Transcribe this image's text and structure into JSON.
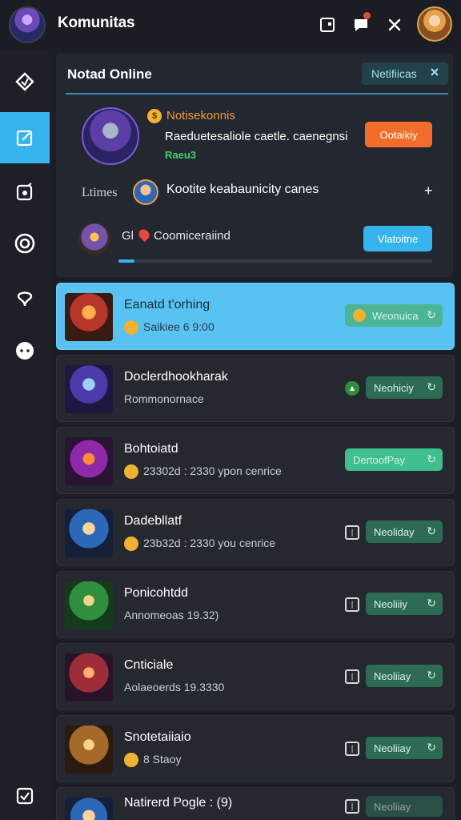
{
  "app": {
    "title": "Komunitas"
  },
  "header": {
    "icons": [
      "window-icon",
      "chat-icon",
      "close-icon"
    ],
    "notification_dot": true
  },
  "sidebar": {
    "items": [
      "home-icon",
      "edit-icon",
      "note-icon",
      "target-icon",
      "pin-icon",
      "chat-icon",
      "check-icon"
    ],
    "active_index": 1
  },
  "panel": {
    "title": "Notad Online",
    "tag_label": "Netifiicas",
    "featured": {
      "name": "Notisekonnis",
      "description": "Raeduetesaliole caetle. caenegnsi",
      "sub": "Raeu3",
      "button": "Ootaikiy"
    },
    "row2": {
      "label": "Ltimes",
      "text": "Kootite keabaunicity canes",
      "plus": "+"
    },
    "row3": {
      "text": "Gl",
      "text2": "Coomiceraiind",
      "button": "Vlatoitne",
      "progress": 0.05
    }
  },
  "list": [
    {
      "title": "Eanatd t'orhing",
      "sub": "Saikiee 6 9:00",
      "chip": "Weonuica",
      "active": true,
      "icon": "coin"
    },
    {
      "title": "Doclerdhookharak",
      "sub": "Rommonornace",
      "chip": "Neohiciy",
      "active": false,
      "icon": "leaf"
    },
    {
      "title": "Bohtoiatd",
      "sub": "23302d : 2330 ypon cenrice",
      "chip": "DertoofPay",
      "active": false,
      "icon": "coin"
    },
    {
      "title": "Dadebllatf",
      "sub": "23b32d : 2330 you cenrice",
      "chip": "Neoliday",
      "active": false,
      "icon": "coin"
    },
    {
      "title": "Ponicohtdd",
      "sub": "Annomeoas 19.32)",
      "chip": "Neoliiiy",
      "active": false,
      "icon": "none"
    },
    {
      "title": "Cnticiale",
      "sub": "Aolaeoerds 19.3330",
      "chip": "Neoliiay",
      "active": false,
      "icon": "none"
    },
    {
      "title": "Snotetaiiaio",
      "sub": "8 Staoy",
      "chip": "Neoliiay",
      "active": false,
      "icon": "coin"
    },
    {
      "title": "Natirerd Pogle : (9)",
      "sub": "",
      "chip": "Neoliiay",
      "active": false,
      "icon": "none"
    }
  ],
  "colors": {
    "accent": "#37b3ee",
    "orange": "#f36d2a",
    "green_chip": "#2e6b55"
  }
}
